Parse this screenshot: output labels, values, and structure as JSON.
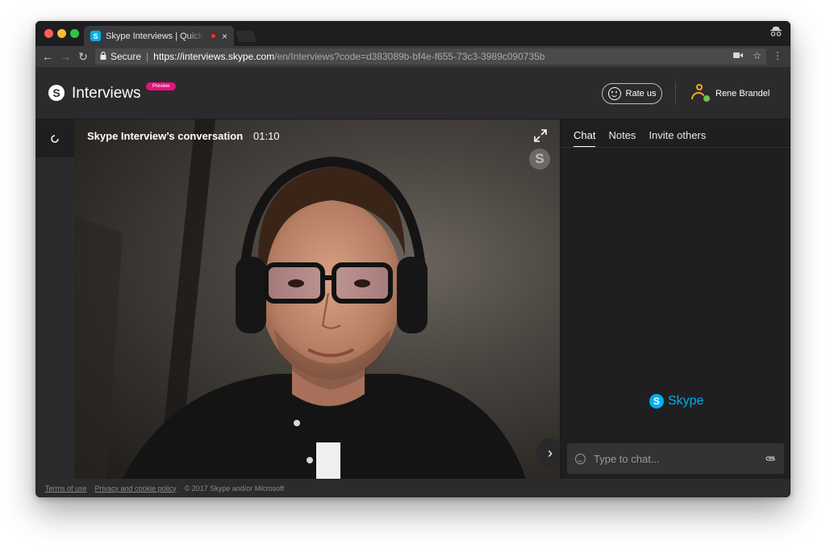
{
  "browser": {
    "tab_title": "Skype Interviews | Quick and",
    "tab_favicon": "S",
    "close_glyph": "×",
    "secure_label": "Secure",
    "url_host": "https://interviews.skype.com",
    "url_path": "/en/Interviews?code=d383089b-bf4e-f655-73c3-3989c090735b",
    "icons": [
      "back-arrow-icon",
      "forward-arrow-icon",
      "reload-icon",
      "lock-icon",
      "camera-icon",
      "star-icon",
      "menu-icon",
      "incognito-icon"
    ]
  },
  "header": {
    "logo_glyph": "S",
    "app_title": "Interviews",
    "preview_badge": "Preview",
    "rate_label": "Rate us",
    "user_name": "Rene Brandel"
  },
  "video": {
    "conversation_title": "Skype Interview’s conversation",
    "elapsed_time": "01:10",
    "watermark_glyph": "S"
  },
  "side_panel": {
    "tabs": [
      {
        "label": "Chat",
        "active": true
      },
      {
        "label": "Notes",
        "active": false
      },
      {
        "label": "Invite others",
        "active": false
      }
    ],
    "brand_glyph": "S",
    "brand_name": "Skype",
    "chat_placeholder": "Type to chat..."
  },
  "footer": {
    "terms_label": "Terms of use",
    "privacy_label": "Privacy and cookie policy",
    "copyright": "© 2017 Skype and/or Microsoft"
  },
  "colors": {
    "accent_blue": "#00aff0",
    "preview_pink": "#e3147a",
    "avatar_orange": "#f5a623",
    "online_green": "#6cc04a"
  }
}
